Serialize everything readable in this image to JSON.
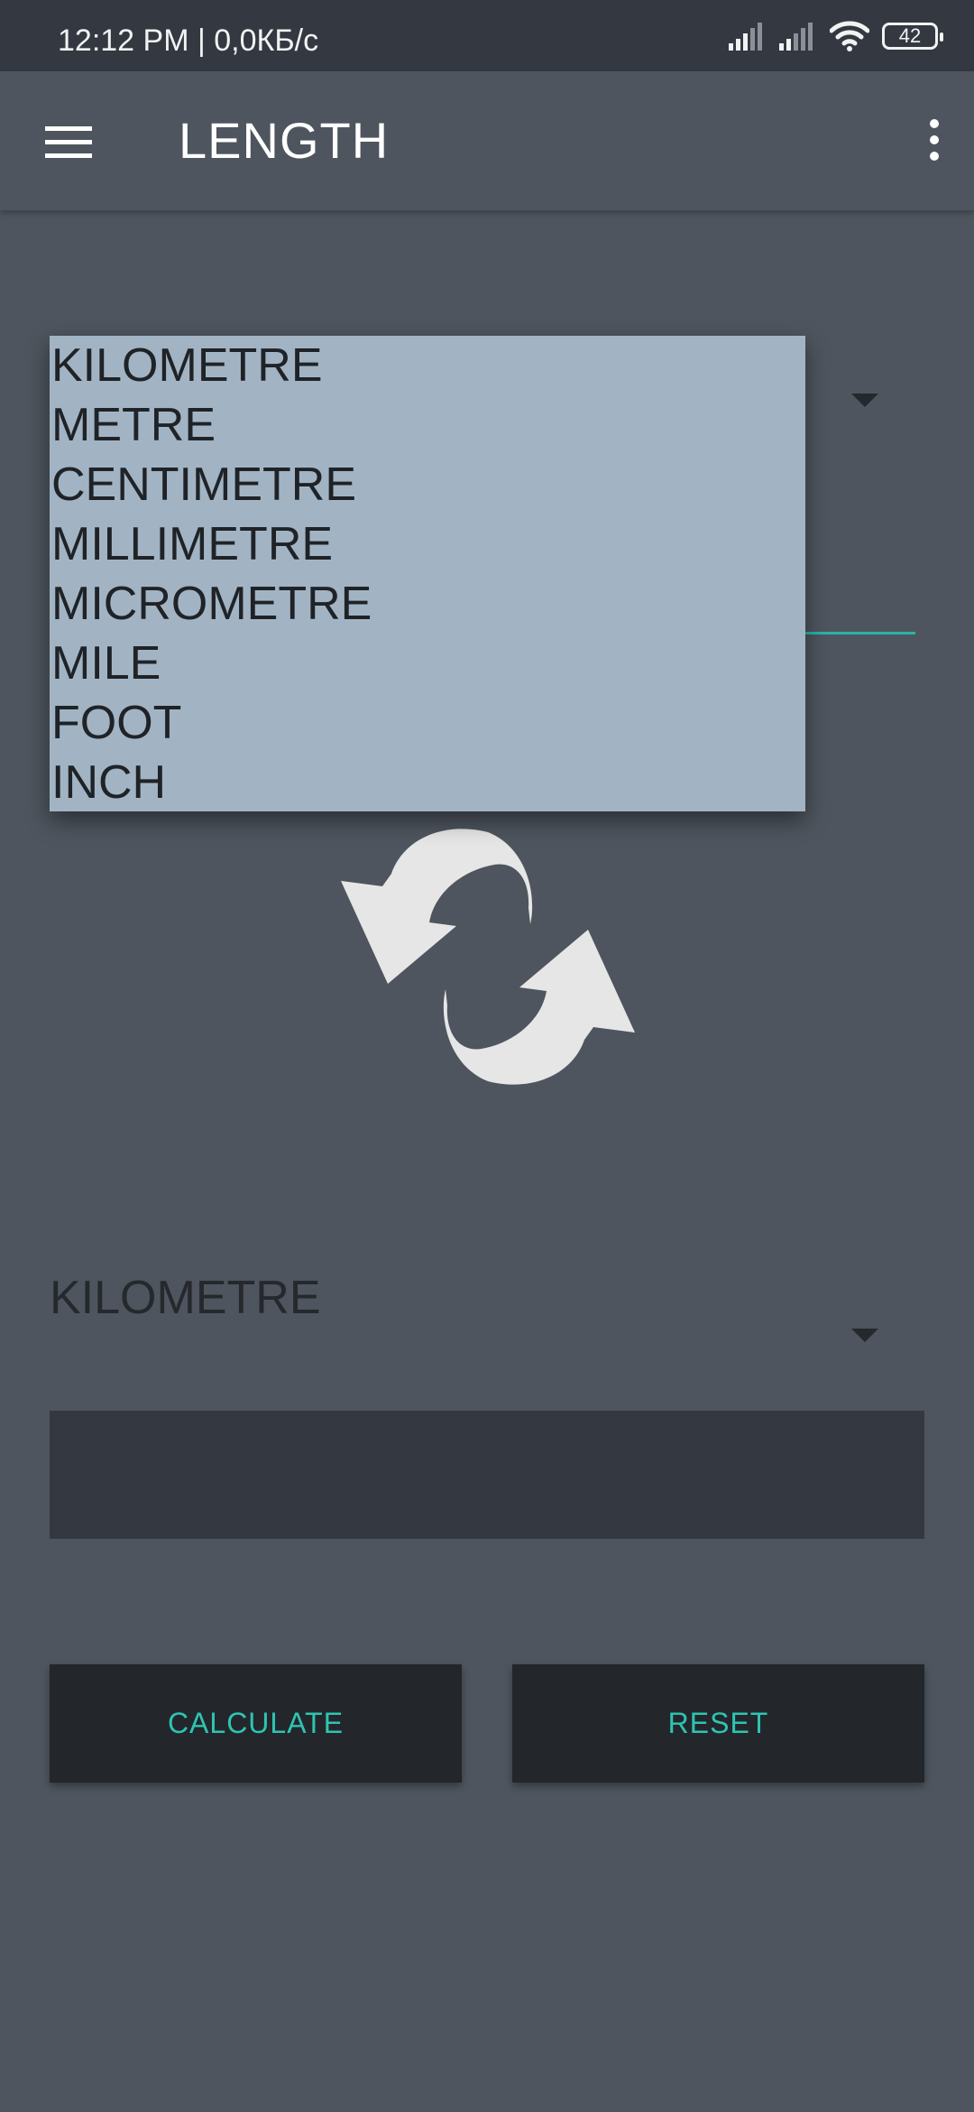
{
  "status_bar": {
    "time_text": "12:12 PM | 0,0КБ/с",
    "battery_level": "42",
    "signal_icons": [
      "signal-icon",
      "signal-icon"
    ],
    "wifi_icon": "wifi-icon"
  },
  "toolbar": {
    "title": "LENGTH",
    "menu_icon": "hamburger-menu-icon",
    "overflow_icon": "more-vert-icon"
  },
  "dropdown": {
    "items": [
      "KILOMETRE",
      "METRE",
      "CENTIMETRE",
      "MILLIMETRE",
      "MICROMETRE",
      "MILE",
      "FOOT",
      "INCH"
    ]
  },
  "to_unit": {
    "selected": "KILOMETRE"
  },
  "result": {
    "value": ""
  },
  "buttons": {
    "calculate_label": "CALCULATE",
    "reset_label": "RESET"
  },
  "colors": {
    "background": "#4e555e",
    "status_bar": "#333841",
    "dropdown": "#a2b4c4",
    "button_bg": "#23272b",
    "accent": "#2fc4b2"
  }
}
